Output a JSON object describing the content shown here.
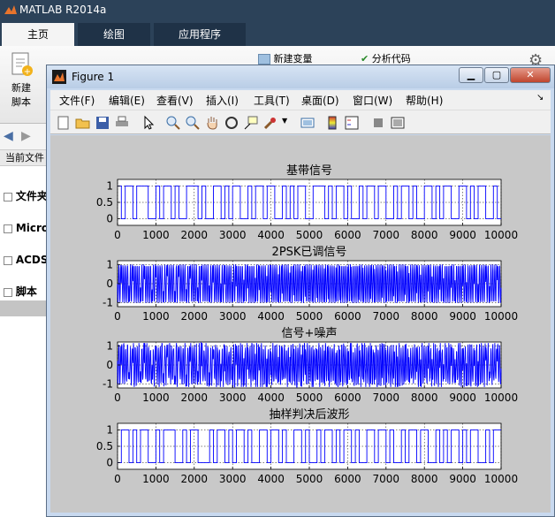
{
  "app": {
    "title": "MATLAB R2014a"
  },
  "ribbon": {
    "tabs": [
      {
        "label": "主页",
        "active": true
      },
      {
        "label": "绘图",
        "active": false
      },
      {
        "label": "应用程序",
        "active": false
      }
    ],
    "new_script_line1": "新建",
    "new_script_line2": "脚本",
    "new_variable": "新建变量",
    "analyze_code": "分析代码"
  },
  "left_panel": {
    "current_folder": "当前文件",
    "tree": [
      {
        "label": "文件夹",
        "icon": "minus-icon"
      },
      {
        "label": "Micro",
        "icon": "minus-icon"
      },
      {
        "label": "ACDS",
        "icon": "minus-icon"
      },
      {
        "label": "脚本",
        "icon": "minus-icon"
      }
    ]
  },
  "figure": {
    "title": "Figure 1",
    "menu": [
      "文件(F)",
      "编辑(E)",
      "查看(V)",
      "插入(I)",
      "工具(T)",
      "桌面(D)",
      "窗口(W)",
      "帮助(H)"
    ],
    "colors": {
      "signal": "#0000ff",
      "axes_bg": "#ffffff",
      "figure_bg": "#c8c8c8"
    }
  },
  "chart_data": [
    {
      "type": "line",
      "title": "基带信号",
      "xlim": [
        0,
        10000
      ],
      "ylim": [
        -0.2,
        1.2
      ],
      "xticks": [
        0,
        1000,
        2000,
        3000,
        4000,
        5000,
        6000,
        7000,
        8000,
        9000,
        10000
      ],
      "yticks": [
        0,
        0.5,
        1
      ],
      "ytick_labels": [
        "0",
        "0.5",
        "1"
      ],
      "grid": "dashed",
      "waveform": "binary-square",
      "bits": [
        1,
        0,
        1,
        1,
        0,
        1,
        1,
        1,
        0,
        0,
        1,
        0,
        1,
        1,
        0,
        1,
        0,
        0,
        1,
        1,
        1,
        0,
        1,
        0,
        0,
        1,
        1,
        0,
        1,
        0,
        1,
        1,
        0,
        0,
        1,
        0,
        1,
        1,
        0,
        1,
        1,
        0,
        0,
        1,
        0,
        1,
        0,
        1,
        1,
        0,
        0,
        1,
        1,
        1,
        0,
        1,
        0,
        1,
        1,
        0,
        1,
        0,
        0,
        1,
        0,
        1,
        1,
        0,
        1,
        1,
        0,
        0,
        1,
        0,
        1,
        1,
        0,
        1,
        0,
        0,
        1,
        1,
        0,
        1,
        0,
        1,
        1,
        0,
        0,
        1,
        1,
        0,
        1,
        0,
        1,
        1,
        0,
        0,
        1,
        0
      ]
    },
    {
      "type": "line",
      "title": "2PSK已调信号",
      "xlim": [
        0,
        10000
      ],
      "ylim": [
        -1.2,
        1.2
      ],
      "xticks": [
        0,
        1000,
        2000,
        3000,
        4000,
        5000,
        6000,
        7000,
        8000,
        9000,
        10000
      ],
      "yticks": [
        -1,
        0,
        1
      ],
      "ytick_labels": [
        "-1",
        "0",
        "1"
      ],
      "grid": "dashed",
      "waveform": "psk-carrier"
    },
    {
      "type": "line",
      "title": "信号+噪声",
      "xlim": [
        0,
        10000
      ],
      "ylim": [
        -1.2,
        1.2
      ],
      "xticks": [
        0,
        1000,
        2000,
        3000,
        4000,
        5000,
        6000,
        7000,
        8000,
        9000,
        10000
      ],
      "yticks": [
        -1,
        0,
        1
      ],
      "ytick_labels": [
        "-1",
        "0",
        "1"
      ],
      "grid": "dashed",
      "waveform": "noisy-carrier"
    },
    {
      "type": "line",
      "title": "抽样判决后波形",
      "xlim": [
        0,
        10000
      ],
      "ylim": [
        -0.2,
        1.2
      ],
      "xticks": [
        0,
        1000,
        2000,
        3000,
        4000,
        5000,
        6000,
        7000,
        8000,
        9000,
        10000
      ],
      "yticks": [
        0,
        0.5,
        1
      ],
      "ytick_labels": [
        "0",
        "0.5",
        "1"
      ],
      "grid": "dashed",
      "waveform": "binary-square",
      "bits": [
        0,
        1,
        1,
        0,
        1,
        0,
        1,
        1,
        0,
        0,
        1,
        0,
        1,
        1,
        1,
        0,
        0,
        1,
        0,
        1,
        1,
        0,
        0,
        0,
        1,
        0,
        1,
        1,
        0,
        1,
        0,
        1,
        1,
        0,
        1,
        0,
        0,
        1,
        1,
        0,
        1,
        1,
        0,
        1,
        0,
        0,
        1,
        1,
        0,
        1,
        0,
        0,
        1,
        0,
        1,
        1,
        0,
        1,
        0,
        1,
        1,
        0,
        1,
        0,
        0,
        1,
        1,
        0,
        1,
        1,
        0,
        1,
        0,
        0,
        1,
        0,
        1,
        1,
        0,
        1,
        1,
        0,
        0,
        1,
        0,
        1,
        0,
        1,
        1,
        0,
        1,
        0,
        1,
        1,
        0,
        0,
        1,
        0,
        1,
        1
      ]
    }
  ]
}
